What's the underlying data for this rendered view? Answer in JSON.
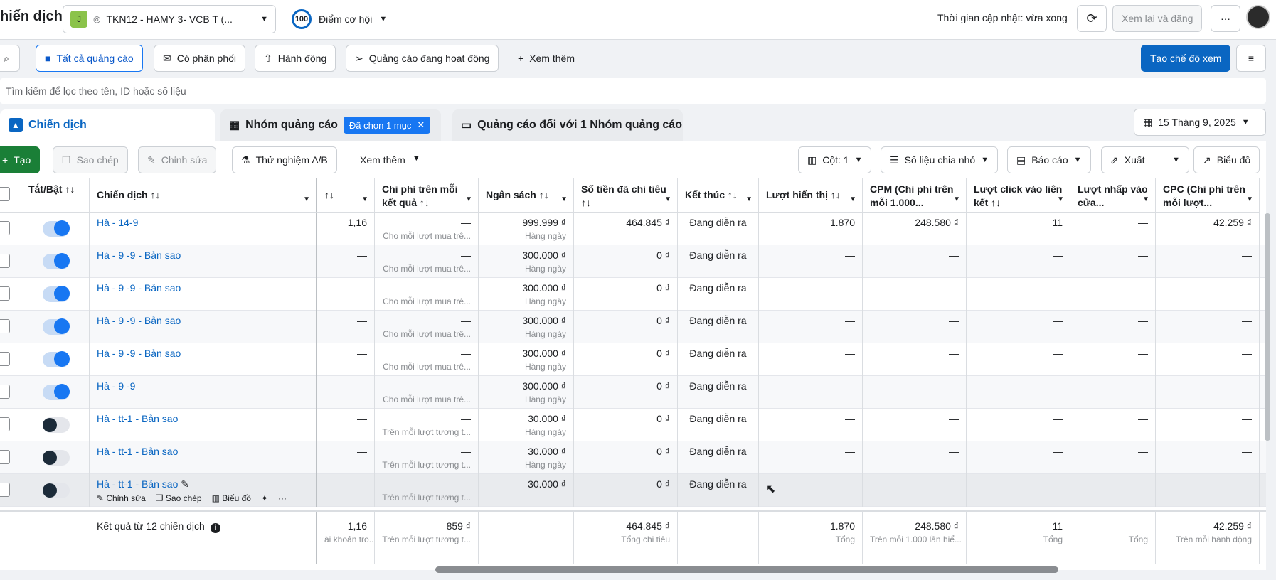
{
  "header": {
    "title": "hiến dịch",
    "account_initial": "J",
    "account_name": "TKN12 - HAMY 3- VCB T (...",
    "score_badge": "100",
    "score_label": "Điểm cơ hội",
    "updated": "Thời gian cập nhật: vừa xong",
    "review_publish": "Xem lại và đăng",
    "more": "···"
  },
  "filters": {
    "all_ads": "Tất cả quảng cáo",
    "delivery": "Có phân phối",
    "actions": "Hành động",
    "active_ads": "Quảng cáo đang hoạt động",
    "see_more": "Xem thêm",
    "create_view": "Tạo chế độ xem"
  },
  "search": {
    "placeholder": "Tìm kiếm để lọc theo tên, ID hoặc số liệu"
  },
  "tabs": {
    "campaigns": "Chiến dịch",
    "adsets": "Nhóm quảng cáo",
    "selected": "Đã chọn 1 mục",
    "ads": "Quảng cáo đối với 1 Nhóm quảng cáo",
    "date": "15 Tháng 9, 2025"
  },
  "toolbar": {
    "create": "Tạo",
    "copy": "Sao chép",
    "edit": "Chỉnh sửa",
    "ab": "Thử nghiệm A/B",
    "more": "Xem thêm",
    "columns": "Cột: 1",
    "breakdown": "Số liệu chia nhỏ",
    "reports": "Báo cáo",
    "export": "Xuất",
    "chart": "Biểu đồ"
  },
  "columns": {
    "toggle": "Tắt/Bật ↑↓",
    "campaign": "Chiến dịch ↑↓",
    "results": "↑↓",
    "cpr": "Chi phí trên mỗi kết quả ↑↓",
    "budget": "Ngân sách ↑↓",
    "spent": "Số tiền đã chi tiêu ↑↓",
    "ends": "Kết thúc ↑↓",
    "impressions": "Lượt hiển thị ↑↓",
    "cpm": "CPM (Chi phí trên mỗi 1.000...",
    "link_clicks": "Lượt click vào liên kết ↑↓",
    "store_visits": "Lượt nhấp vào cửa...",
    "cpc": "CPC (Chi phí trên mỗi lượt..."
  },
  "rows": [
    {
      "name": "Hà - 14-9",
      "on": true,
      "results": "1,16",
      "cpr": "—",
      "cpr_sub": "Cho mỗi lượt mua trê...",
      "budget": "999.999 ₫",
      "budget_sub": "Hàng ngày",
      "spent": "464.845 ₫",
      "ends": "Đang diễn ra",
      "impr": "1.870",
      "cpm": "248.580 ₫",
      "clicks": "11",
      "store": "—",
      "cpc": "42.259 ₫"
    },
    {
      "name": "Hà - 9 -9 - Bản sao",
      "on": true,
      "results": "—",
      "cpr": "—",
      "cpr_sub": "Cho mỗi lượt mua trê...",
      "budget": "300.000 ₫",
      "budget_sub": "Hàng ngày",
      "spent": "0 ₫",
      "ends": "Đang diễn ra",
      "impr": "—",
      "cpm": "—",
      "clicks": "—",
      "store": "—",
      "cpc": "—"
    },
    {
      "name": "Hà - 9 -9 - Bản sao",
      "on": true,
      "results": "—",
      "cpr": "—",
      "cpr_sub": "Cho mỗi lượt mua trê...",
      "budget": "300.000 ₫",
      "budget_sub": "Hàng ngày",
      "spent": "0 ₫",
      "ends": "Đang diễn ra",
      "impr": "—",
      "cpm": "—",
      "clicks": "—",
      "store": "—",
      "cpc": "—"
    },
    {
      "name": "Hà - 9 -9 - Bản sao",
      "on": true,
      "results": "—",
      "cpr": "—",
      "cpr_sub": "Cho mỗi lượt mua trê...",
      "budget": "300.000 ₫",
      "budget_sub": "Hàng ngày",
      "spent": "0 ₫",
      "ends": "Đang diễn ra",
      "impr": "—",
      "cpm": "—",
      "clicks": "—",
      "store": "—",
      "cpc": "—"
    },
    {
      "name": "Hà - 9 -9 - Bản sao",
      "on": true,
      "results": "—",
      "cpr": "—",
      "cpr_sub": "Cho mỗi lượt mua trê...",
      "budget": "300.000 ₫",
      "budget_sub": "Hàng ngày",
      "spent": "0 ₫",
      "ends": "Đang diễn ra",
      "impr": "—",
      "cpm": "—",
      "clicks": "—",
      "store": "—",
      "cpc": "—"
    },
    {
      "name": "Hà - 9 -9",
      "on": true,
      "results": "—",
      "cpr": "—",
      "cpr_sub": "Cho mỗi lượt mua trê...",
      "budget": "300.000 ₫",
      "budget_sub": "Hàng ngày",
      "spent": "0 ₫",
      "ends": "Đang diễn ra",
      "impr": "—",
      "cpm": "—",
      "clicks": "—",
      "store": "—",
      "cpc": "—"
    },
    {
      "name": "Hà - tt-1 - Bản sao",
      "on": false,
      "results": "—",
      "cpr": "—",
      "cpr_sub": "Trên mỗi lượt tương t...",
      "budget": "30.000 ₫",
      "budget_sub": "Hàng ngày",
      "spent": "0 ₫",
      "ends": "Đang diễn ra",
      "impr": "—",
      "cpm": "—",
      "clicks": "—",
      "store": "—",
      "cpc": "—"
    },
    {
      "name": "Hà - tt-1 - Bản sao",
      "on": false,
      "results": "—",
      "cpr": "—",
      "cpr_sub": "Trên mỗi lượt tương t...",
      "budget": "30.000 ₫",
      "budget_sub": "Hàng ngày",
      "spent": "0 ₫",
      "ends": "Đang diễn ra",
      "impr": "—",
      "cpm": "—",
      "clicks": "—",
      "store": "—",
      "cpc": "—"
    },
    {
      "name": "Hà - tt-1 - Bản sao",
      "on": false,
      "results": "—",
      "cpr": "—",
      "cpr_sub": "Trên mỗi lượt tương t...",
      "budget": "30.000 ₫",
      "budget_sub": "",
      "spent": "0 ₫",
      "ends": "Đang diễn ra",
      "impr": "—",
      "cpm": "—",
      "clicks": "—",
      "store": "—",
      "cpc": "—"
    }
  ],
  "row_actions": {
    "edit": "Chỉnh sửa",
    "copy": "Sao chép",
    "chart": "Biểu đồ",
    "more": "···"
  },
  "footer": {
    "label": "Kết quả từ 12 chiến dịch",
    "results": "1,16",
    "results_sub": "ài khoản tro...",
    "cpr": "859 ₫",
    "cpr_sub": "Trên mỗi lượt tương t...",
    "spent": "464.845 ₫",
    "spent_sub": "Tổng chi tiêu",
    "impr": "1.870",
    "impr_sub": "Tổng",
    "cpm": "248.580 ₫",
    "cpm_sub": "Trên mỗi 1.000 lần hiể...",
    "clicks": "11",
    "clicks_sub": "Tổng",
    "store": "—",
    "store_sub": "Tổng",
    "cpc": "42.259 ₫",
    "cpc_sub": "Trên mỗi hành động"
  }
}
